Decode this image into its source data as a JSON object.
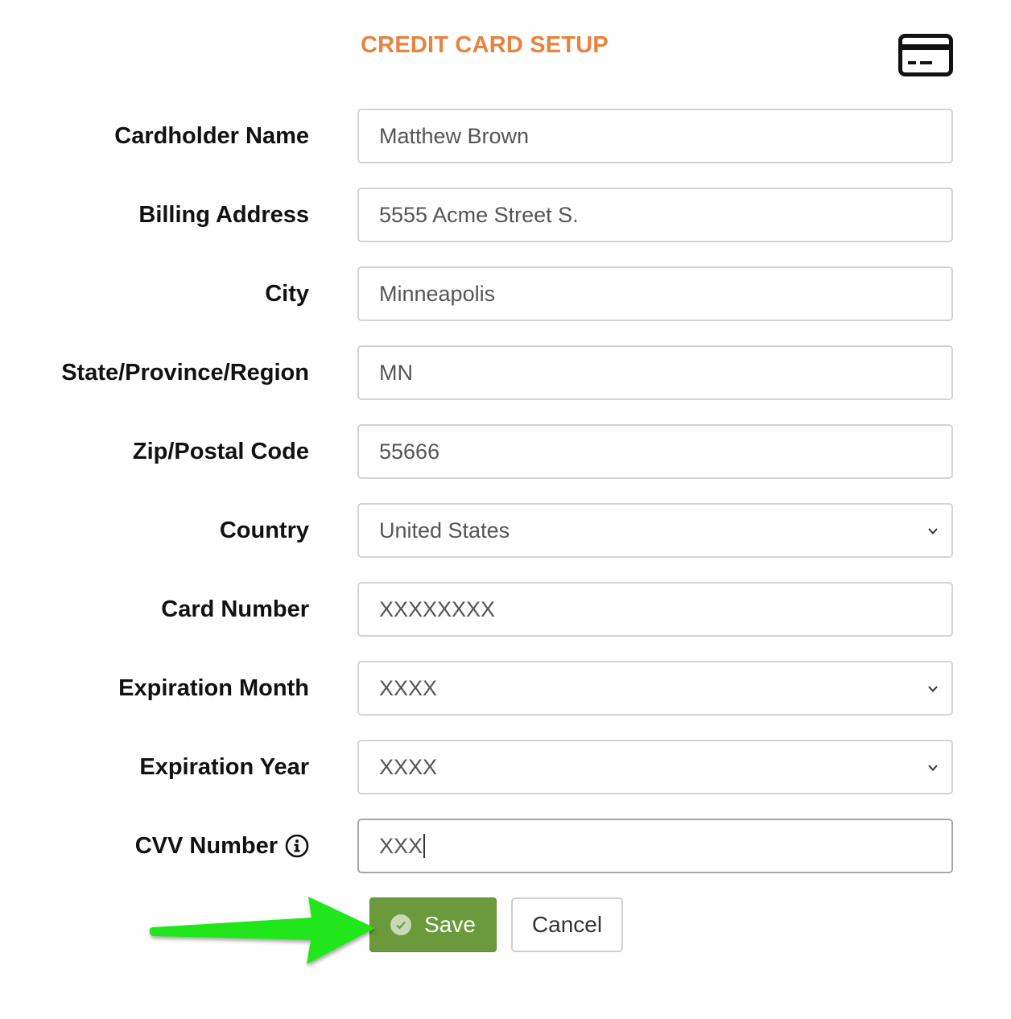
{
  "header": {
    "title": "CREDIT CARD SETUP",
    "icon": "credit-card-icon"
  },
  "form": {
    "cardholder_name": {
      "label": "Cardholder Name",
      "value": "Matthew Brown"
    },
    "billing_address": {
      "label": "Billing Address",
      "value": "5555 Acme Street S."
    },
    "city": {
      "label": "City",
      "value": "Minneapolis"
    },
    "state": {
      "label": "State/Province/Region",
      "value": "MN"
    },
    "zip": {
      "label": "Zip/Postal Code",
      "value": "55666"
    },
    "country": {
      "label": "Country",
      "value": "United States"
    },
    "card_number": {
      "label": "Card Number",
      "value": "XXXXXXXX"
    },
    "exp_month": {
      "label": "Expiration Month",
      "value": "XXXX"
    },
    "exp_year": {
      "label": "Expiration Year",
      "value": "XXXX"
    },
    "cvv": {
      "label": "CVV Number",
      "value": "XXX",
      "info_icon": "info-icon"
    }
  },
  "actions": {
    "save_label": "Save",
    "cancel_label": "Cancel",
    "save_icon": "check-circle-icon"
  },
  "annotation": {
    "arrow_icon": "arrow-right-icon"
  },
  "colors": {
    "title": "#e8823f",
    "save_button": "#6a9a3c",
    "arrow": "#22e61a"
  }
}
